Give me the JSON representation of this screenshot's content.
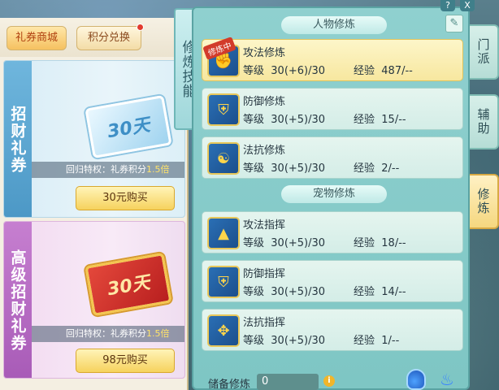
{
  "shop": {
    "tabs": [
      {
        "label": "礼券商城",
        "active": true
      },
      {
        "label": "积分兑换",
        "active": false,
        "has_red_dot": true
      }
    ],
    "cards": [
      {
        "side_label": "招财礼券",
        "ticket_text": "30天",
        "perk_prefix": "回归特权：礼券积分",
        "perk_value": "1.5倍",
        "buy_label": "30元购买"
      },
      {
        "side_label": "高级招财礼券",
        "ticket_text": "30天",
        "perk_prefix": "回归特权：礼券积分",
        "perk_value": "1.5倍",
        "buy_label": "98元购买"
      }
    ]
  },
  "skill_tab": {
    "label": "修炼技能"
  },
  "panel": {
    "sections": [
      {
        "title": "人物修炼",
        "rows": [
          {
            "name": "攻法修炼",
            "level_label": "等级",
            "level": "30(+6)/30",
            "exp_label": "经验",
            "exp": "487/--",
            "badge": "修炼中",
            "icon": "fist-icon",
            "selected": true
          },
          {
            "name": "防御修炼",
            "level_label": "等级",
            "level": "30(+5)/30",
            "exp_label": "经验",
            "exp": "15/--",
            "icon": "shield-icon",
            "selected": false
          },
          {
            "name": "法抗修炼",
            "level_label": "等级",
            "level": "30(+5)/30",
            "exp_label": "经验",
            "exp": "2/--",
            "icon": "yin-yang-icon",
            "selected": false
          }
        ]
      },
      {
        "title": "宠物修炼",
        "rows": [
          {
            "name": "攻法指挥",
            "level_label": "等级",
            "level": "30(+5)/30",
            "exp_label": "经验",
            "exp": "18/--",
            "icon": "paw-attack-icon",
            "selected": false
          },
          {
            "name": "防御指挥",
            "level_label": "等级",
            "level": "30(+5)/30",
            "exp_label": "经验",
            "exp": "14/--",
            "icon": "paw-shield-icon",
            "selected": false
          },
          {
            "name": "法抗指挥",
            "level_label": "等级",
            "level": "30(+5)/30",
            "exp_label": "经验",
            "exp": "1/--",
            "icon": "paw-resist-icon",
            "selected": false
          }
        ]
      }
    ],
    "footer": {
      "reserve_label": "储备修炼",
      "reserve_value": "0"
    }
  },
  "side_tabs": [
    {
      "label": "门派",
      "active": false
    },
    {
      "label": "辅助",
      "active": false
    },
    {
      "label": "修炼",
      "active": true
    }
  ],
  "top_icons": {
    "help": "?",
    "close": "X"
  }
}
